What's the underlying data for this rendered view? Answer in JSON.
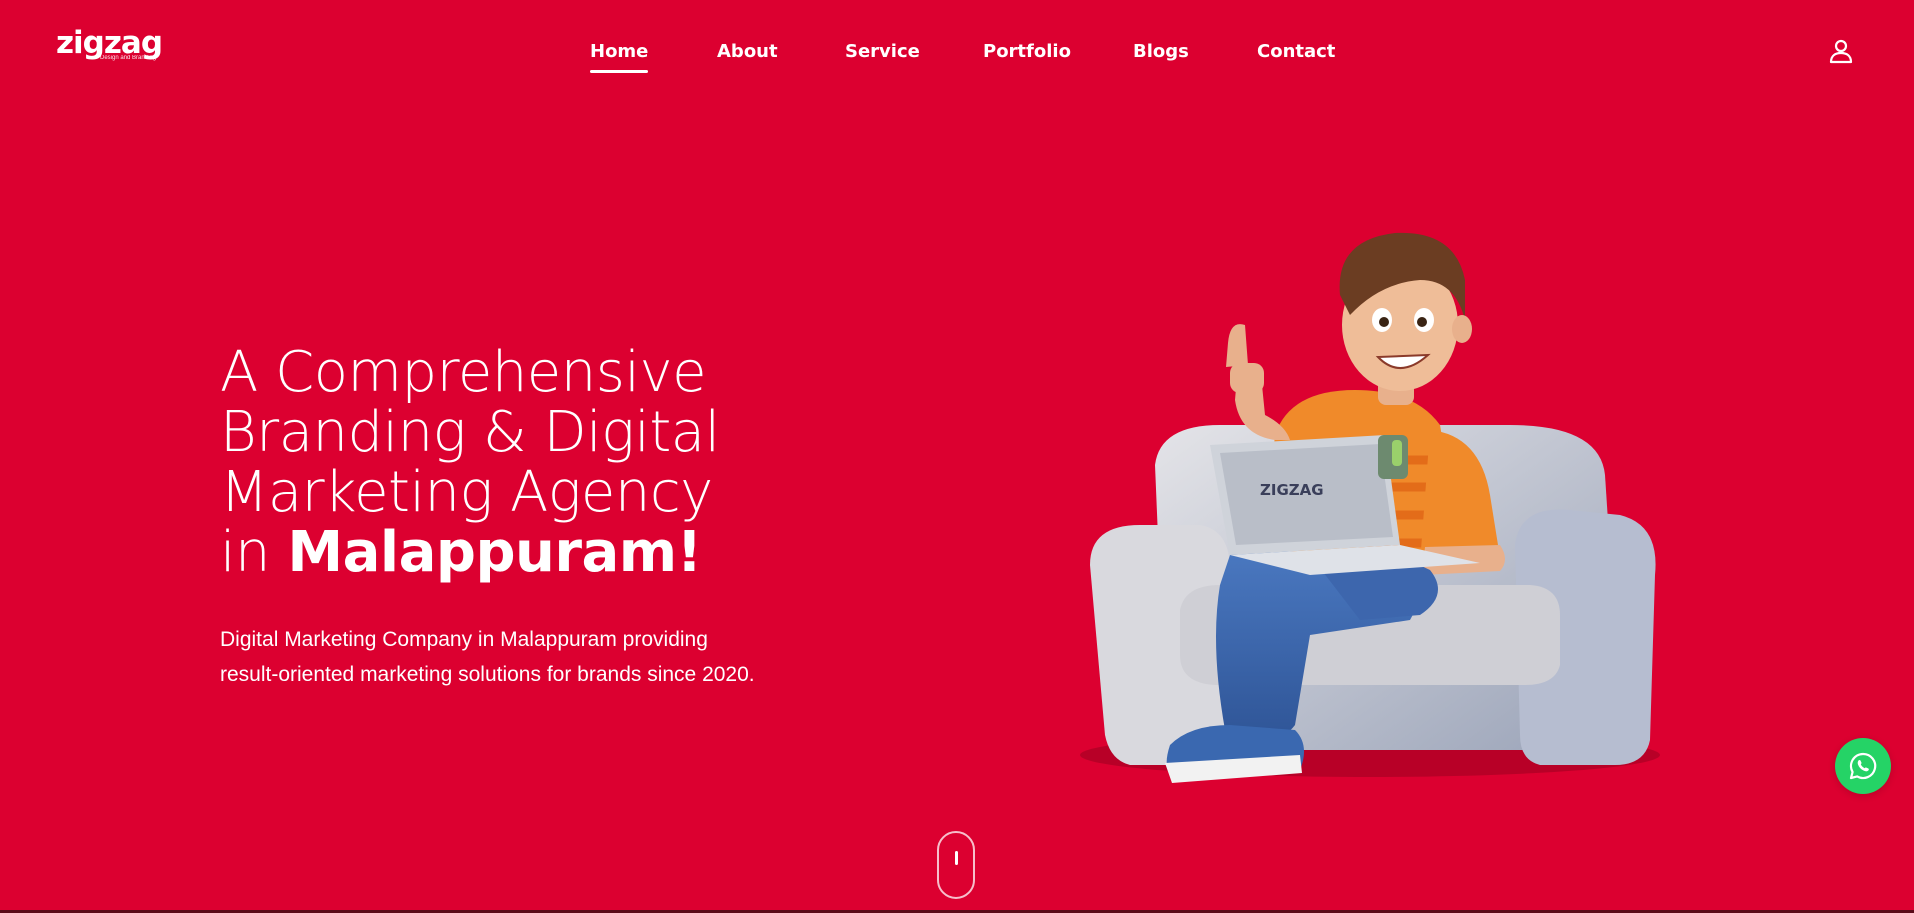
{
  "logo": {
    "text": "zigzag",
    "tagline": "Design and Branding"
  },
  "nav": {
    "items": [
      {
        "label": "Home",
        "active": true
      },
      {
        "label": "About"
      },
      {
        "label": "Service"
      },
      {
        "label": "Portfolio"
      },
      {
        "label": "Blogs"
      },
      {
        "label": "Contact"
      }
    ]
  },
  "hero": {
    "title_line1": "A Comprehensive",
    "title_line2": "Branding & Digital",
    "title_line3": "Marketing Agency",
    "title_line4_prefix": "in ",
    "title_line4_bold": "Malappuram!",
    "subtitle_line1": "Digital Marketing Company in Malappuram providing",
    "subtitle_line2": "result-oriented marketing solutions for brands since 2020.",
    "laptop_logo": "ZIGZAG"
  },
  "icons": {
    "user": "user-icon",
    "whatsapp": "whatsapp-icon",
    "scroll": "mouse-scroll-icon"
  },
  "colors": {
    "background": "#dc0030",
    "text": "#ffffff",
    "whatsapp": "#25d366"
  }
}
